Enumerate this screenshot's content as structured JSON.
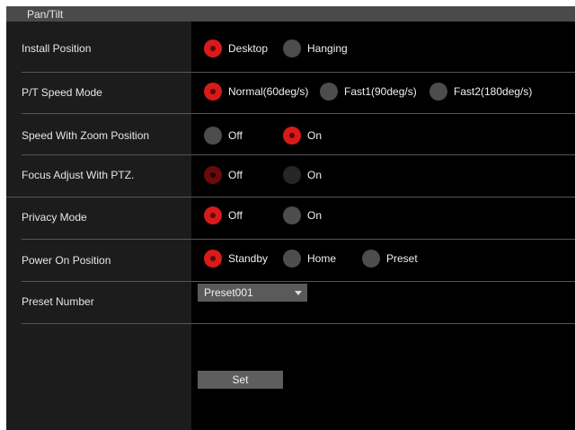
{
  "title": "Pan/Tilt",
  "rows": [
    {
      "label": "Install Position",
      "options": [
        {
          "label": "Desktop",
          "selected": true
        },
        {
          "label": "Hanging",
          "selected": false
        }
      ]
    },
    {
      "label": "P/T Speed Mode",
      "options": [
        {
          "label": "Normal(60deg/s)",
          "selected": true
        },
        {
          "label": "Fast1(90deg/s)",
          "selected": false
        },
        {
          "label": "Fast2(180deg/s)",
          "selected": false
        }
      ]
    },
    {
      "label": "Speed With Zoom Position",
      "options": [
        {
          "label": "Off",
          "selected": false
        },
        {
          "label": "On",
          "selected": true
        }
      ]
    },
    {
      "label": "Focus Adjust With PTZ.",
      "disabled": true,
      "options": [
        {
          "label": "Off",
          "selected": true
        },
        {
          "label": "On",
          "selected": false
        }
      ]
    },
    {
      "label": "Privacy Mode",
      "options": [
        {
          "label": "Off",
          "selected": true
        },
        {
          "label": "On",
          "selected": false
        }
      ]
    },
    {
      "label": "Power On Position",
      "options": [
        {
          "label": "Standby",
          "selected": true
        },
        {
          "label": "Home",
          "selected": false
        },
        {
          "label": "Preset",
          "selected": false
        }
      ]
    }
  ],
  "preset_number": {
    "label": "Preset Number",
    "value": "Preset001"
  },
  "set_button": "Set",
  "colors": {
    "selected": "#d91a1a",
    "unselected": "#4d4d4d",
    "title_bar": "#4a4a4a",
    "label_column": "#1c1c1c"
  }
}
